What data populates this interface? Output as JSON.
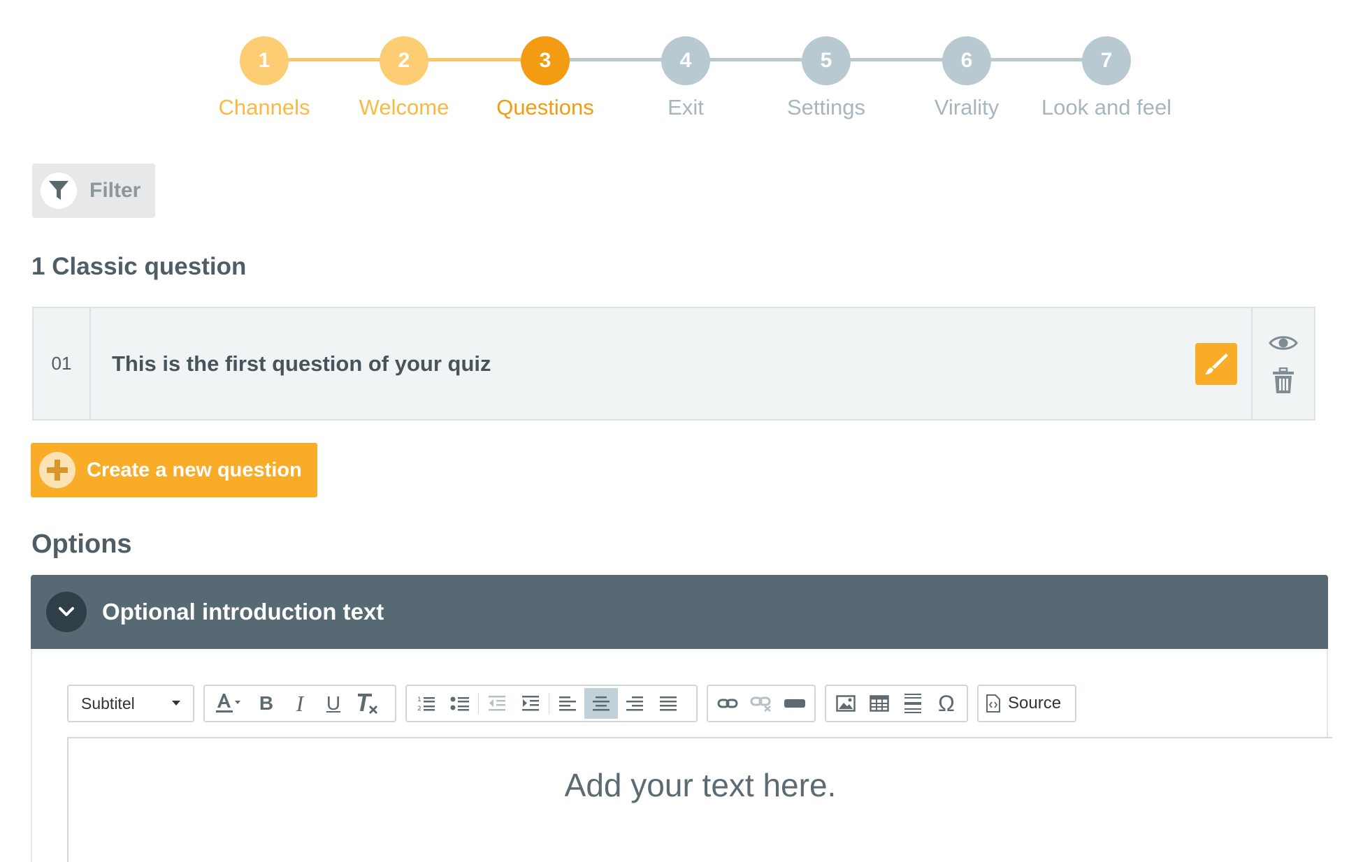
{
  "stepper": {
    "steps": [
      {
        "number": "1",
        "label": "Channels",
        "state": "done"
      },
      {
        "number": "2",
        "label": "Welcome",
        "state": "done"
      },
      {
        "number": "3",
        "label": "Questions",
        "state": "current"
      },
      {
        "number": "4",
        "label": "Exit",
        "state": "todo"
      },
      {
        "number": "5",
        "label": "Settings",
        "state": "todo"
      },
      {
        "number": "6",
        "label": "Virality",
        "state": "todo"
      },
      {
        "number": "7",
        "label": "Look and feel",
        "state": "todo"
      }
    ],
    "colors": {
      "done_circle": "#fdcd73",
      "done_label": "#fbb944",
      "current_circle": "#f39c12",
      "current_label": "#f39c12",
      "todo_circle": "#b9c9d2",
      "todo_label": "#a6b6bf",
      "done_line": "#fcc567",
      "todo_line": "#b9c9d2"
    }
  },
  "filter": {
    "label": "Filter",
    "icon": "funnel-icon"
  },
  "questions_section": {
    "title": "1 Classic question"
  },
  "questions": [
    {
      "number": "01",
      "text": "This is the first question of your quiz"
    }
  ],
  "create_button": {
    "label": "Create a new question",
    "icon": "plus-icon"
  },
  "options": {
    "title": "Options",
    "panel_title": "Optional introduction text",
    "editor": {
      "format_value": "Subtitel",
      "source_label": "Source",
      "placeholder": "Add your text here."
    }
  },
  "colors": {
    "accent": "#f9ac28",
    "panel_header": "#576a74",
    "heading_text": "#4f5d65"
  }
}
